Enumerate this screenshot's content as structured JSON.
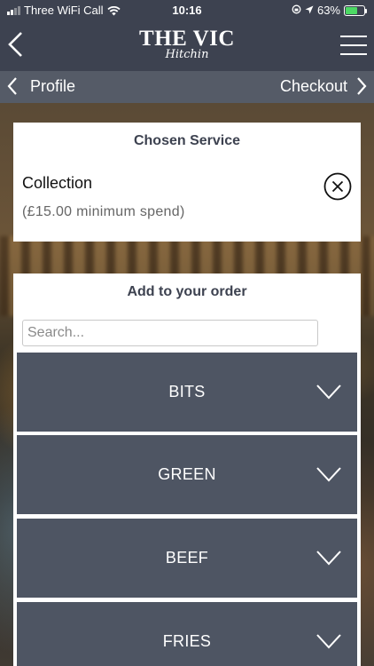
{
  "status_bar": {
    "carrier": "Three WiFi Call",
    "time": "10:16",
    "battery": "63%",
    "battery_level": 0.63
  },
  "header": {
    "logo_main": "THE VIC",
    "logo_sub": "Hitchin",
    "back_icon": "chevron-left-icon",
    "menu_icon": "hamburger-menu-icon"
  },
  "nav": {
    "prev_label": "Profile",
    "next_label": "Checkout"
  },
  "service": {
    "heading": "Chosen Service",
    "name": "Collection",
    "note": "(£15.00 minimum spend)"
  },
  "order": {
    "heading": "Add to your order",
    "search_placeholder": "Search...",
    "categories": [
      {
        "label": "BITS"
      },
      {
        "label": "GREEN"
      },
      {
        "label": "BEEF"
      },
      {
        "label": "FRIES"
      }
    ]
  },
  "colors": {
    "header_bg": "#3d4250",
    "nav_bg": "#555b67",
    "category_bg": "#4e5563",
    "battery_fill": "#4cd964"
  }
}
